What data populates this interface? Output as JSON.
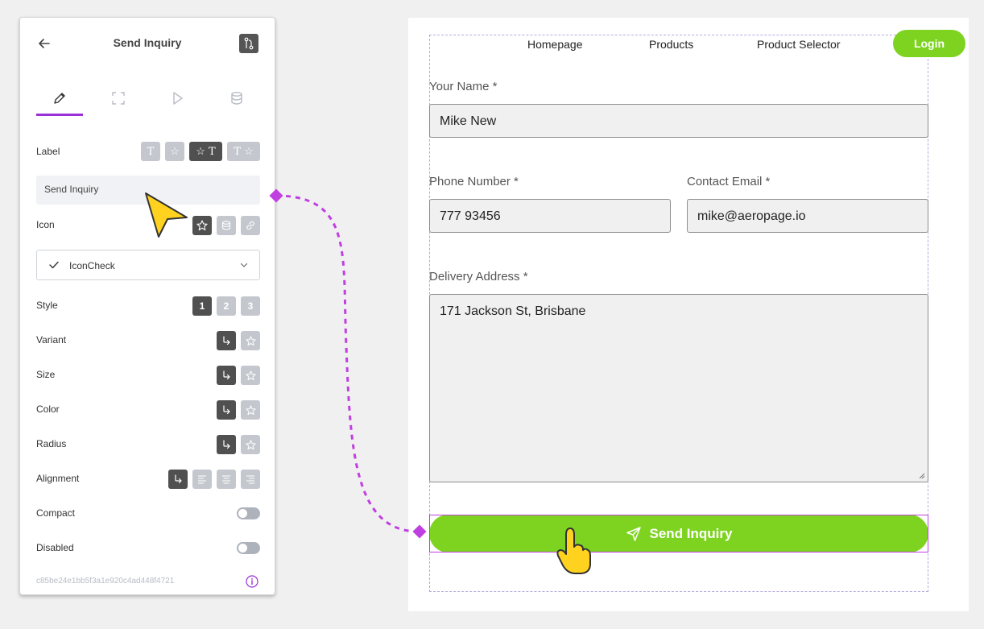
{
  "panel": {
    "title": "Send Inquiry",
    "tabs": [
      {
        "name": "edit",
        "icon": "pencil-icon",
        "active": true
      },
      {
        "name": "layout",
        "icon": "frame-icon"
      },
      {
        "name": "actions",
        "icon": "play-icon"
      },
      {
        "name": "data",
        "icon": "database-icon"
      }
    ],
    "label_row": {
      "label": "Label",
      "options": [
        "T",
        "☆",
        "☆ T",
        "T ☆"
      ],
      "selected_index": 2
    },
    "label_value": "Send Inquiry",
    "icon_row": {
      "label": "Icon"
    },
    "icon_select": {
      "value": "IconCheck"
    },
    "style_row": {
      "label": "Style",
      "options": [
        "1",
        "2",
        "3"
      ],
      "selected_index": 0
    },
    "variant_label": "Variant",
    "size_label": "Size",
    "color_label": "Color",
    "radius_label": "Radius",
    "alignment_label": "Alignment",
    "compact_label": "Compact",
    "compact_on": false,
    "disabled_label": "Disabled",
    "disabled_on": false,
    "id": "c85be24e1bb5f3a1e920c4ad448f4721"
  },
  "nav": {
    "links": [
      "Homepage",
      "Products",
      "Product Selector"
    ],
    "login": "Login"
  },
  "form": {
    "name_label": "Your Name *",
    "name_value": "Mike New",
    "phone_label": "Phone Number *",
    "phone_value": "777 93456",
    "email_label": "Contact Email *",
    "email_value": "mike@aeropage.io",
    "address_label": "Delivery Address *",
    "address_value": "171 Jackson St, Brisbane",
    "submit_label": "Send Inquiry"
  },
  "colors": {
    "accent_green": "#7ed321",
    "connector_purple": "#c03fe0",
    "tab_underline": "#9b30d9"
  }
}
